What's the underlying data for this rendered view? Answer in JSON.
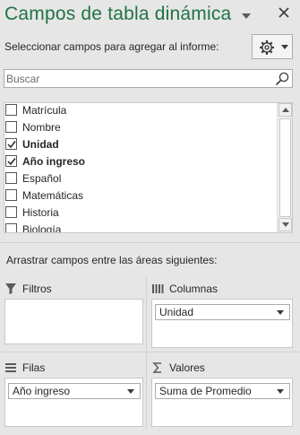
{
  "header": {
    "title": "Campos de tabla dinámica",
    "subtitle": "Seleccionar campos para agregar al informe:"
  },
  "search": {
    "placeholder": "Buscar",
    "value": ""
  },
  "fields": [
    {
      "label": "Matrícula",
      "checked": false
    },
    {
      "label": "Nombre",
      "checked": false
    },
    {
      "label": "Unidad",
      "checked": true
    },
    {
      "label": "Año ingreso",
      "checked": true
    },
    {
      "label": "Español",
      "checked": false
    },
    {
      "label": "Matemáticas",
      "checked": false
    },
    {
      "label": "Historia",
      "checked": false
    },
    {
      "label": "Biología",
      "checked": false
    }
  ],
  "areas": {
    "instruction": "Arrastrar campos entre las áreas siguientes:",
    "filters": {
      "label": "Filtros",
      "icon": "filter-icon",
      "items": []
    },
    "columns": {
      "label": "Columnas",
      "icon": "columns-icon",
      "items": [
        "Unidad"
      ]
    },
    "rows": {
      "label": "Filas",
      "icon": "rows-icon",
      "items": [
        "Año ingreso"
      ]
    },
    "values": {
      "label": "Valores",
      "icon": "sigma-icon",
      "items": [
        "Suma de Promedio"
      ]
    }
  },
  "colors": {
    "title": "#217346",
    "panel": "#e6e6e6",
    "border": "#ababab"
  }
}
